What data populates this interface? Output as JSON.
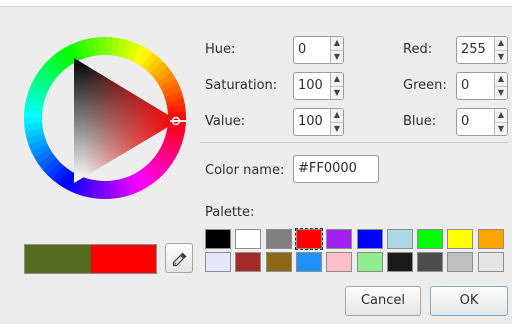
{
  "fields": {
    "hue": {
      "label": "Hue:",
      "value": "0"
    },
    "saturation": {
      "label": "Saturation:",
      "value": "100"
    },
    "value": {
      "label": "Value:",
      "value": "100"
    },
    "red": {
      "label": "Red:",
      "value": "255"
    },
    "green": {
      "label": "Green:",
      "value": "0"
    },
    "blue": {
      "label": "Blue:",
      "value": "0"
    }
  },
  "color_name": {
    "label": "Color name:",
    "value": "#FF0000"
  },
  "palette": {
    "label": "Palette:",
    "colors": [
      "#000000",
      "#ffffff",
      "#808080",
      "#ff0000",
      "#a020f0",
      "#0000ff",
      "#add8e6",
      "#00ff00",
      "#ffff00",
      "#ffa500",
      "#e6e6fa",
      "#a52a2a",
      "#8b6914",
      "#1e90ff",
      "#ffc0cb",
      "#90ee90",
      "#1a1a1a",
      "#4d4d4d",
      "#bfbfbf",
      "#e5e5e5"
    ]
  },
  "preview": {
    "previous_color": "#556b1f",
    "current_color": "#ff0000"
  },
  "icons": {
    "picker": "eyedropper-icon"
  },
  "buttons": {
    "cancel": "Cancel",
    "ok": "OK"
  }
}
